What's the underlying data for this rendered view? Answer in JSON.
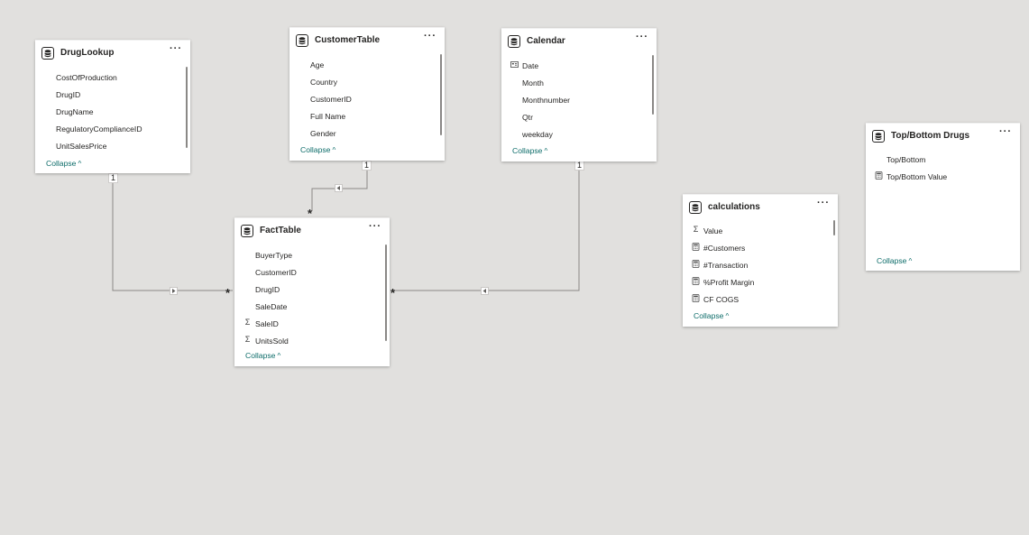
{
  "tables": {
    "drug_lookup": {
      "title": "DrugLookup",
      "fields": [
        "CostOfProduction",
        "DrugID",
        "DrugName",
        "RegulatoryComplianceID",
        "UnitSalesPrice"
      ],
      "collapse": "Collapse"
    },
    "customer_table": {
      "title": "CustomerTable",
      "fields": [
        "Age",
        "Country",
        "CustomerID",
        "Full Name",
        "Gender"
      ],
      "collapse": "Collapse"
    },
    "calendar": {
      "title": "Calendar",
      "fields": [
        {
          "icon": "calendar-hierarchy-icon",
          "label": "Date"
        },
        {
          "icon": "",
          "label": "Month"
        },
        {
          "icon": "",
          "label": "Monthnumber"
        },
        {
          "icon": "",
          "label": "Qtr"
        },
        {
          "icon": "",
          "label": "weekday"
        }
      ],
      "collapse": "Collapse"
    },
    "fact_table": {
      "title": "FactTable",
      "fields": [
        {
          "icon": "",
          "label": "BuyerType"
        },
        {
          "icon": "",
          "label": "CustomerID"
        },
        {
          "icon": "",
          "label": "DrugID"
        },
        {
          "icon": "",
          "label": "SaleDate"
        },
        {
          "icon": "sigma-icon",
          "label": "SaleID"
        },
        {
          "icon": "sigma-icon",
          "label": "UnitsSold"
        }
      ],
      "collapse": "Collapse"
    },
    "calculations": {
      "title": "calculations",
      "fields": [
        {
          "icon": "sigma-icon",
          "label": "Value"
        },
        {
          "icon": "calculator-icon",
          "label": "#Customers"
        },
        {
          "icon": "calculator-icon",
          "label": "#Transaction"
        },
        {
          "icon": "calculator-icon",
          "label": "%Profit Margin"
        },
        {
          "icon": "calculator-icon",
          "label": "CF COGS"
        }
      ],
      "collapse": "Collapse"
    },
    "top_bottom": {
      "title": "Top/Bottom Drugs",
      "fields": [
        {
          "icon": "",
          "label": "Top/Bottom"
        },
        {
          "icon": "calculator-icon",
          "label": "Top/Bottom Value"
        }
      ],
      "collapse": "Collapse"
    }
  },
  "relationships": [
    {
      "from": "DrugLookup",
      "to": "FactTable",
      "one_label": "1",
      "many_label": "*",
      "direction": "single"
    },
    {
      "from": "CustomerTable",
      "to": "FactTable",
      "one_label": "1",
      "many_label": "*",
      "direction": "single"
    },
    {
      "from": "Calendar",
      "to": "FactTable",
      "one_label": "1",
      "many_label": "*",
      "direction": "single"
    }
  ],
  "ui": {
    "more_label": "···",
    "collapse_chevron": "^",
    "background": "#e1e0de",
    "collapse_color": "#0e6d6a"
  }
}
